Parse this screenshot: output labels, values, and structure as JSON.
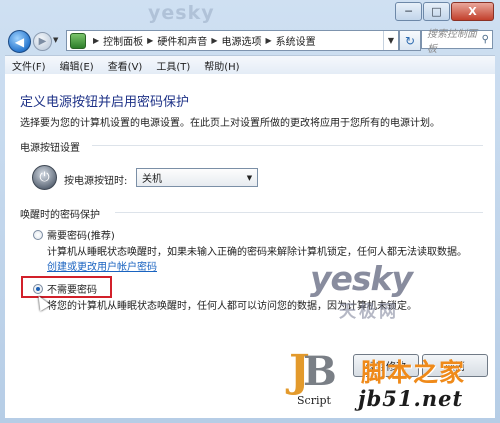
{
  "window": {
    "watermark_top": "yesky",
    "buttons": {
      "minimize": "─",
      "maximize": "□",
      "close": "X"
    }
  },
  "navbar": {
    "back_glyph": "◀",
    "forward_glyph": "▶",
    "breadcrumbs": [
      "控制面板",
      "硬件和声音",
      "电源选项",
      "系统设置"
    ],
    "refresh_glyph": "↻",
    "search_placeholder": "搜索控制面板"
  },
  "menu": [
    "文件(F)",
    "编辑(E)",
    "查看(V)",
    "工具(T)",
    "帮助(H)"
  ],
  "page": {
    "title": "定义电源按钮并启用密码保护",
    "description": "选择要为您的计算机设置的电源设置。在此页上对设置所做的更改将应用于您所有的电源计划。",
    "power_section": "电源按钮设置",
    "power_button_label": "按电源按钮时:",
    "power_button_value": "关机",
    "wake_section": "唤醒时的密码保护",
    "option_require": "需要密码(推荐)",
    "option_require_desc": "计算机从睡眠状态唤醒时，如果未输入正确的密码来解除计算机锁定，任何人都无法读取数据。",
    "link_create": "创建或更改用户帐户密码",
    "option_no_password": "不需要密码",
    "option_no_password_desc": "将您的计算机从睡眠状态唤醒时，任何人都可以访问您的数据，因为计算机未锁定。",
    "selected_option": "不需要密码",
    "save_button": "保存修改",
    "cancel_button": "取消"
  },
  "watermarks": {
    "yesky": "yesky",
    "yesky_cn": "天极网",
    "jb_script": "Script",
    "site_cn": "脚本之家",
    "site_url": "jb51.net"
  },
  "colors": {
    "heading": "#1e3287",
    "link": "#1a63c0",
    "highlight_box": "#d2202a",
    "site_orange": "#ef8a1a"
  }
}
